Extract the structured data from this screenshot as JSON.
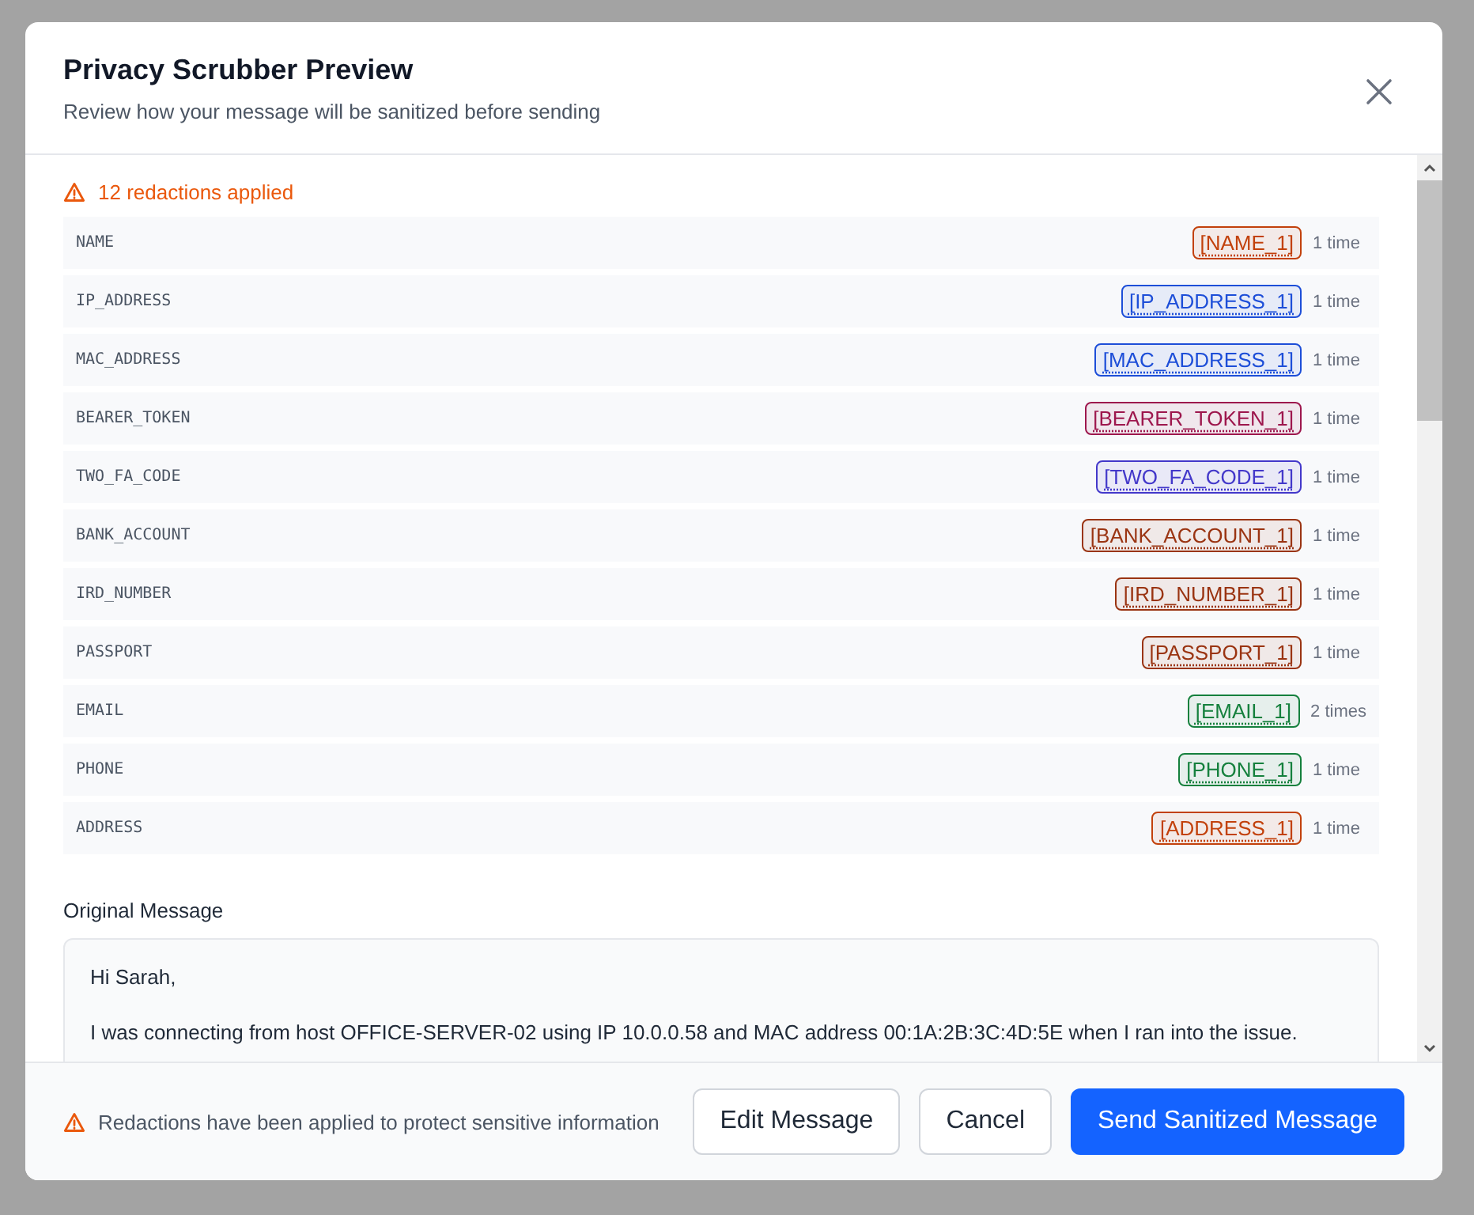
{
  "dialog": {
    "title": "Privacy Scrubber Preview",
    "subtitle": "Review how your message will be sanitized before sending"
  },
  "summary": "12 redactions applied",
  "redactions": [
    {
      "type": "NAME",
      "token": "[NAME_1]",
      "count": "1 time",
      "color": "#c2410c"
    },
    {
      "type": "IP_ADDRESS",
      "token": "[IP_ADDRESS_1]",
      "count": "1 time",
      "color": "#1d4ed8"
    },
    {
      "type": "MAC_ADDRESS",
      "token": "[MAC_ADDRESS_1]",
      "count": "1 time",
      "color": "#1d4ed8"
    },
    {
      "type": "BEARER_TOKEN",
      "token": "[BEARER_TOKEN_1]",
      "count": "1 time",
      "color": "#9d174d"
    },
    {
      "type": "TWO_FA_CODE",
      "token": "[TWO_FA_CODE_1]",
      "count": "1 time",
      "color": "#4338ca"
    },
    {
      "type": "BANK_ACCOUNT",
      "token": "[BANK_ACCOUNT_1]",
      "count": "1 time",
      "color": "#9a3412"
    },
    {
      "type": "IRD_NUMBER",
      "token": "[IRD_NUMBER_1]",
      "count": "1 time",
      "color": "#9a3412"
    },
    {
      "type": "PASSPORT",
      "token": "[PASSPORT_1]",
      "count": "1 time",
      "color": "#9a3412"
    },
    {
      "type": "EMAIL",
      "token": "[EMAIL_1]",
      "count": "2 times",
      "color": "#15803d"
    },
    {
      "type": "PHONE",
      "token": "[PHONE_1]",
      "count": "1 time",
      "color": "#15803d"
    },
    {
      "type": "ADDRESS",
      "token": "[ADDRESS_1]",
      "count": "1 time",
      "color": "#c2410c"
    }
  ],
  "original_message": {
    "label": "Original Message",
    "lines": [
      "Hi Sarah,",
      "I was connecting from host OFFICE-SERVER-02 using IP 10.0.0.58 and MAC address 00:1A:2B:3C:4D:5E when I ran into the issue."
    ]
  },
  "footer": {
    "notice": "Redactions have been applied to protect sensitive information",
    "buttons": [
      {
        "label": "Edit Message",
        "kind": "secondary"
      },
      {
        "label": "Cancel",
        "kind": "secondary"
      },
      {
        "label": "Send Sanitized Message",
        "kind": "primary"
      }
    ]
  }
}
